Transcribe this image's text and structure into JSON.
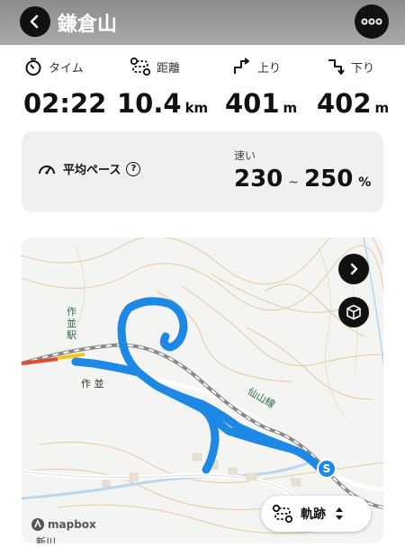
{
  "header": {
    "title": "鎌倉山"
  },
  "stats": {
    "time": {
      "label": "タイム",
      "value": "02:22",
      "unit": ""
    },
    "distance": {
      "label": "距離",
      "value": "10.4",
      "unit": "km"
    },
    "ascent": {
      "label": "上り",
      "value": "401",
      "unit": "m"
    },
    "descent": {
      "label": "下り",
      "value": "402",
      "unit": "m"
    }
  },
  "pace": {
    "label": "平均ペース",
    "speed_label": "速い",
    "range_low": "230",
    "range_sep": "~",
    "range_high": "250",
    "unit": "%"
  },
  "map": {
    "labels": {
      "station_1": "作",
      "station_2": "並",
      "station_3": "駅",
      "area": "作 並",
      "line": "仙山線",
      "river": "新川"
    },
    "logo": "mapbox",
    "track_label": "軌跡",
    "route_color": "#1e88e5",
    "marker_letter": "S"
  }
}
